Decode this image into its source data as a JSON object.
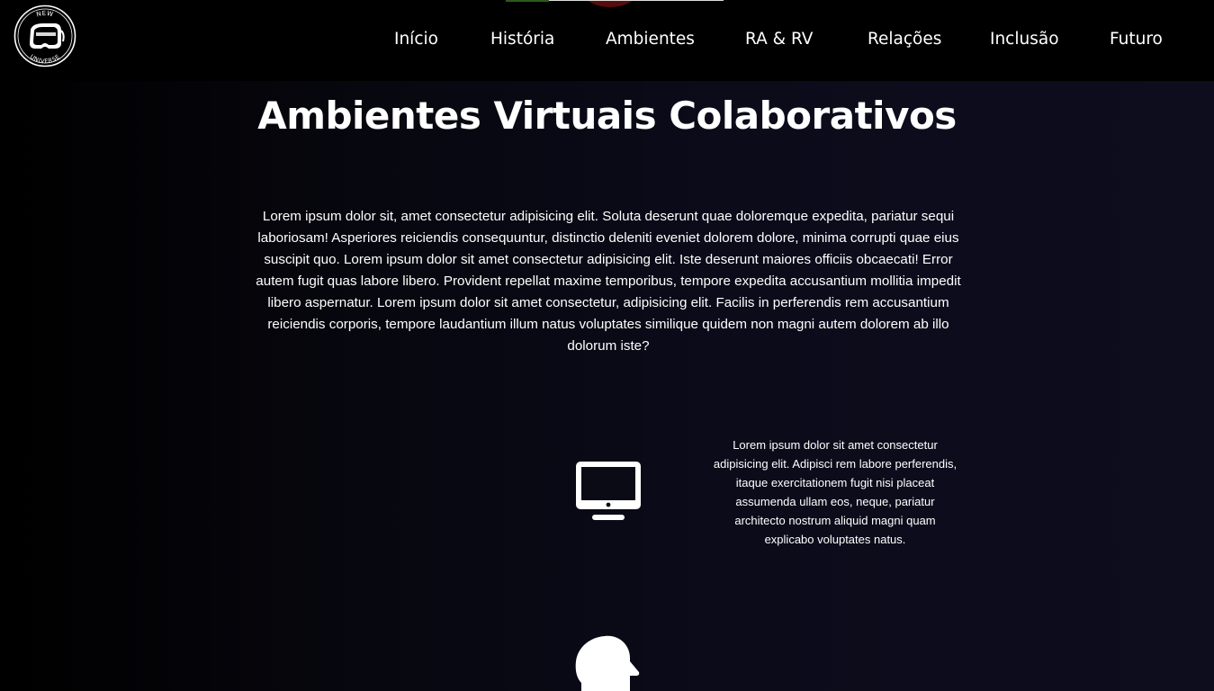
{
  "brand": {
    "logo_text_top": "NEW",
    "logo_text_bottom": "UNIVERSE",
    "logo_icon": "vr-headset-icon"
  },
  "nav": {
    "items": [
      {
        "label": "Início"
      },
      {
        "label": "História"
      },
      {
        "label": "Ambientes"
      },
      {
        "label": "RA & RV"
      },
      {
        "label": "Relações"
      },
      {
        "label": "Inclusão"
      },
      {
        "label": "Futuro"
      }
    ]
  },
  "main": {
    "title": "Ambientes Virtuais Colaborativos",
    "intro": "Lorem ipsum dolor sit, amet consectetur adipisicing elit. Soluta deserunt quae doloremque expedita, pariatur sequi laboriosam! Asperiores reiciendis consequuntur, distinctio deleniti eveniet dolorem dolore, minima corrupti quae eius suscipit quo. Lorem ipsum dolor sit amet consectetur adipisicing elit. Iste deserunt maiores officiis obcaecati! Error autem fugit quas labore libero. Provident repellat maxime temporibus, tempore expedita accusantium mollitia impedit libero aspernatur. Lorem ipsum dolor sit amet consectetur, adipisicing elit. Facilis in perferendis rem accusantium reiciendis corporis, tempore laudantium illum natus voluptates similique quidem non magni autem dolorem ab illo dolorum iste?",
    "features": [
      {
        "icon": "desktop-monitor-icon",
        "text": "Lorem ipsum dolor sit amet consectetur adipisicing elit. Adipisci rem labore perferendis, itaque exercitationem fugit nisi placeat assumenda ullam eos, neque, pariatur architecto nostrum aliquid magni quam explicabo voluptates natus."
      },
      {
        "icon": "head-profile-icon"
      }
    ]
  },
  "colors": {
    "header_bg": "#000000",
    "page_bg_dark": "#000000",
    "page_bg_light": "#0d0d1e",
    "text": "#ffffff"
  }
}
